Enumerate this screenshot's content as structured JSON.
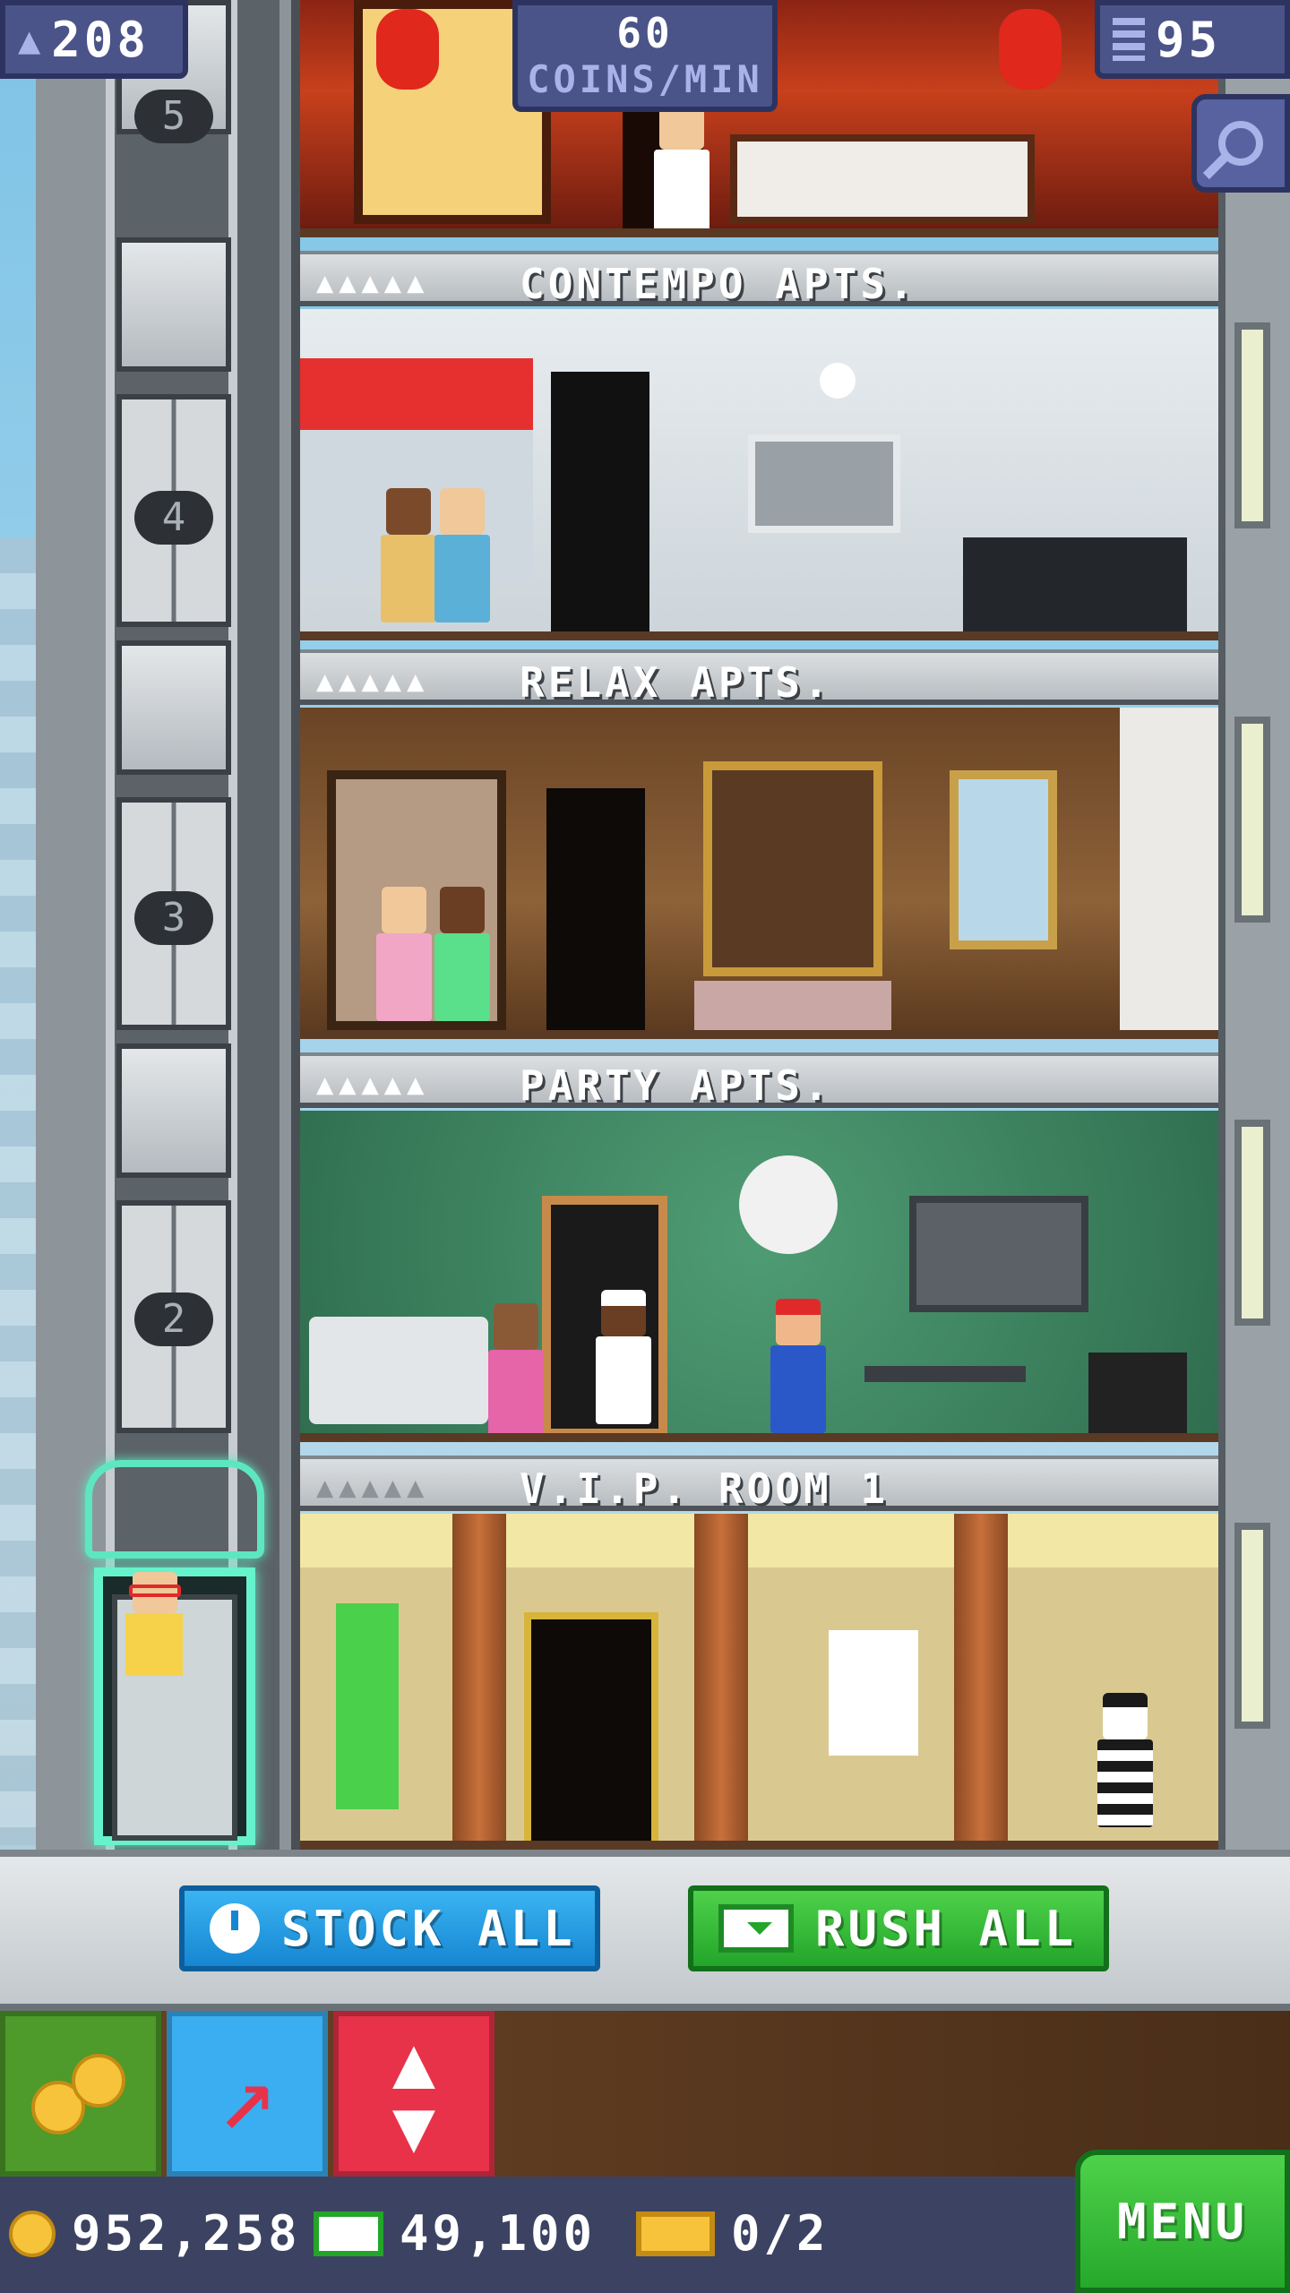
{
  "hud": {
    "population": "208",
    "rate_value": "60",
    "rate_unit": "COINS/MIN",
    "floors": "95"
  },
  "elevator": {
    "floor_labels": [
      "5",
      "4",
      "3",
      "2"
    ]
  },
  "floors": [
    {
      "name": "CONTEMPO APTS.",
      "pips": "▲▲▲▲▲"
    },
    {
      "name": "RELAX APTS.",
      "pips": "▲▲▲▲▲"
    },
    {
      "name": "PARTY APTS.",
      "pips": "▲▲▲▲▲"
    },
    {
      "name": "V.I.P. ROOM 1",
      "pips": "▲▲▲▲▲"
    }
  ],
  "actions": {
    "stock_all": "STOCK ALL",
    "rush_all": "RUSH ALL"
  },
  "status": {
    "coins": "952,258",
    "bux": "49,100",
    "tickets": "0/2",
    "menu": "MENU"
  },
  "icons": {
    "population": "person-icon",
    "floors": "building-icon",
    "search": "magnifier-icon",
    "stock": "clock-icon",
    "rush": "cash-icon",
    "coins_tool": "coins-icon",
    "move_tool": "arrow-icon",
    "elevator_tool": "updown-arrows-icon"
  },
  "colors": {
    "hud_bg": "#4b5488",
    "stock_btn": "#1686d2",
    "rush_btn": "#23a52a",
    "menu_btn": "#26a82c",
    "tool_coins": "#4e9a2a",
    "tool_move": "#3aaef0",
    "tool_elevator": "#e8324a"
  }
}
